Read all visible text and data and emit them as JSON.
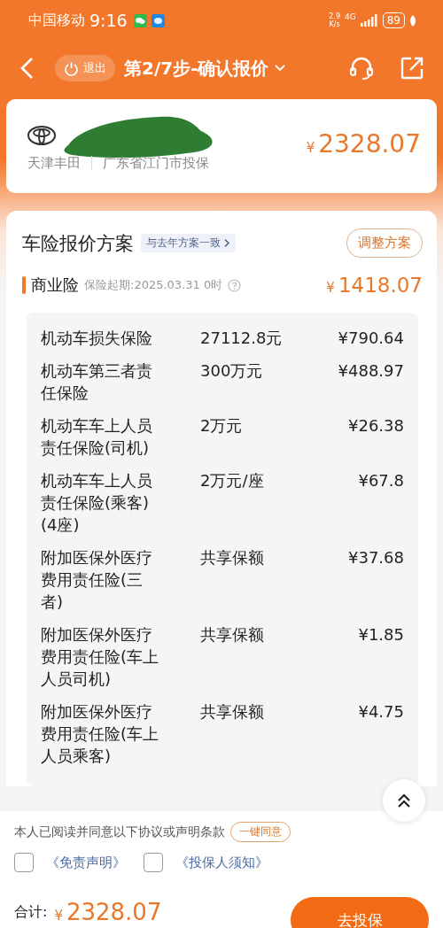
{
  "status_bar": {
    "carrier": "中国移动",
    "time": "9:16",
    "speed_value": "2.9",
    "speed_unit": "K/s",
    "network": "4G",
    "battery": "89"
  },
  "nav": {
    "exit_label": "退出",
    "title": "第2/7步-确认报价"
  },
  "car": {
    "brand": "天津丰田",
    "region": "广东省江门市投保",
    "price_symbol": "¥",
    "price": "2328.07"
  },
  "plan": {
    "title": "车险报价方案",
    "tag": "与去年方案一致",
    "adjust_button": "调整方案"
  },
  "section": {
    "name": "商业险",
    "start": "保险起期:2025.03.31 0时",
    "price_symbol": "¥",
    "price": "1418.07"
  },
  "items": [
    {
      "name": "机动车损失保险",
      "amount": "27112.8元",
      "premium": "¥790.64"
    },
    {
      "name": "机动车第三者责任保险",
      "amount": "300万元",
      "premium": "¥488.97"
    },
    {
      "name": "机动车车上人员责任保险(司机)",
      "amount": "2万元",
      "premium": "¥26.38"
    },
    {
      "name": "机动车车上人员责任保险(乘客) (4座)",
      "amount": "2万元/座",
      "premium": "¥67.8"
    },
    {
      "name": "附加医保外医疗费用责任险(三者)",
      "amount": "共享保额",
      "premium": "¥37.68"
    },
    {
      "name": "附加医保外医疗费用责任险(车上人员司机)",
      "amount": "共享保额",
      "premium": "¥1.85"
    },
    {
      "name": "附加医保外医疗费用责任险(车上人员乘客)",
      "amount": "共享保额",
      "premium": "¥4.75"
    }
  ],
  "agreement": {
    "text": "本人已阅读并同意以下协议或声明条款",
    "agree_button": "一键同意",
    "docs": [
      {
        "label": "《免责声明》",
        "checked": false
      },
      {
        "label": "《投保人须知》",
        "checked": false
      }
    ]
  },
  "total": {
    "label": "合计:",
    "price_symbol": "¥",
    "amount": "2328.07",
    "button": "去投保"
  }
}
